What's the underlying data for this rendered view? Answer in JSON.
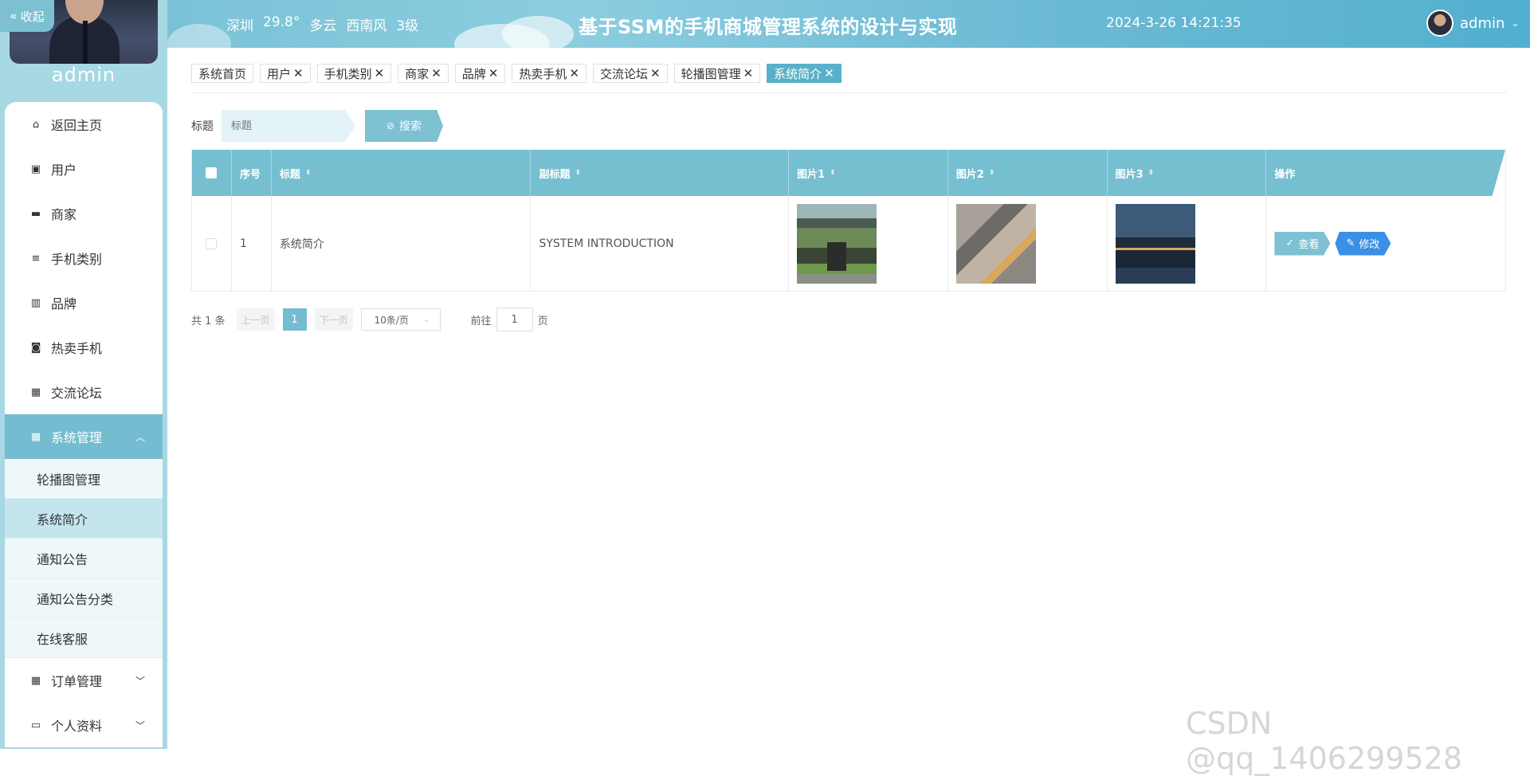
{
  "sidebar": {
    "collapse_label": "收起",
    "user_name": "admin",
    "menu": [
      {
        "label": "返回主页",
        "icon": "home-icon"
      },
      {
        "label": "用户",
        "icon": "clipboard-icon"
      },
      {
        "label": "商家",
        "icon": "store-icon"
      },
      {
        "label": "手机类别",
        "icon": "list-icon"
      },
      {
        "label": "品牌",
        "icon": "book-icon"
      },
      {
        "label": "热卖手机",
        "icon": "ticket-icon"
      },
      {
        "label": "交流论坛",
        "icon": "grid-icon"
      }
    ],
    "system": {
      "label": "系统管理",
      "icon": "grid-icon",
      "subitems": [
        "轮播图管理",
        "系统简介",
        "通知公告",
        "通知公告分类",
        "在线客服"
      ]
    },
    "bottom": [
      {
        "label": "订单管理",
        "icon": "grid-icon"
      },
      {
        "label": "个人资料",
        "icon": "card-icon"
      }
    ]
  },
  "header": {
    "weather": {
      "city": "深圳",
      "temp": "29.8°",
      "condition": "多云",
      "wind": "西南风",
      "level": "3级"
    },
    "title": "基于SSM的手机商城管理系统的设计与实现",
    "datetime": "2024-3-26 14:21:35",
    "user": "admin"
  },
  "tabs": [
    "系统首页",
    "用户",
    "手机类别",
    "商家",
    "品牌",
    "热卖手机",
    "交流论坛",
    "轮播图管理",
    "系统简介"
  ],
  "active_tab": "系统简介",
  "search": {
    "label": "标题",
    "placeholder": "标题",
    "button": "搜索"
  },
  "table": {
    "columns": [
      "序号",
      "标题",
      "副标题",
      "图片1",
      "图片2",
      "图片3",
      "操作"
    ],
    "rows": [
      {
        "index": "1",
        "title": "系统简介",
        "subtitle": "SYSTEM INTRODUCTION",
        "actions": [
          "查看",
          "修改"
        ]
      }
    ]
  },
  "pagination": {
    "total": "共 1 条",
    "prev": "上一页",
    "current": "1",
    "next": "下一页",
    "page_size": "10条/页",
    "goto_label": "前往",
    "goto_value": "1",
    "page_suffix": "页"
  },
  "watermark": "CSDN @qq_1406299528",
  "colors": {
    "accent": "#76bfd0",
    "sidebar": "#a7d8e3",
    "edit_button": "#3a90e6"
  }
}
